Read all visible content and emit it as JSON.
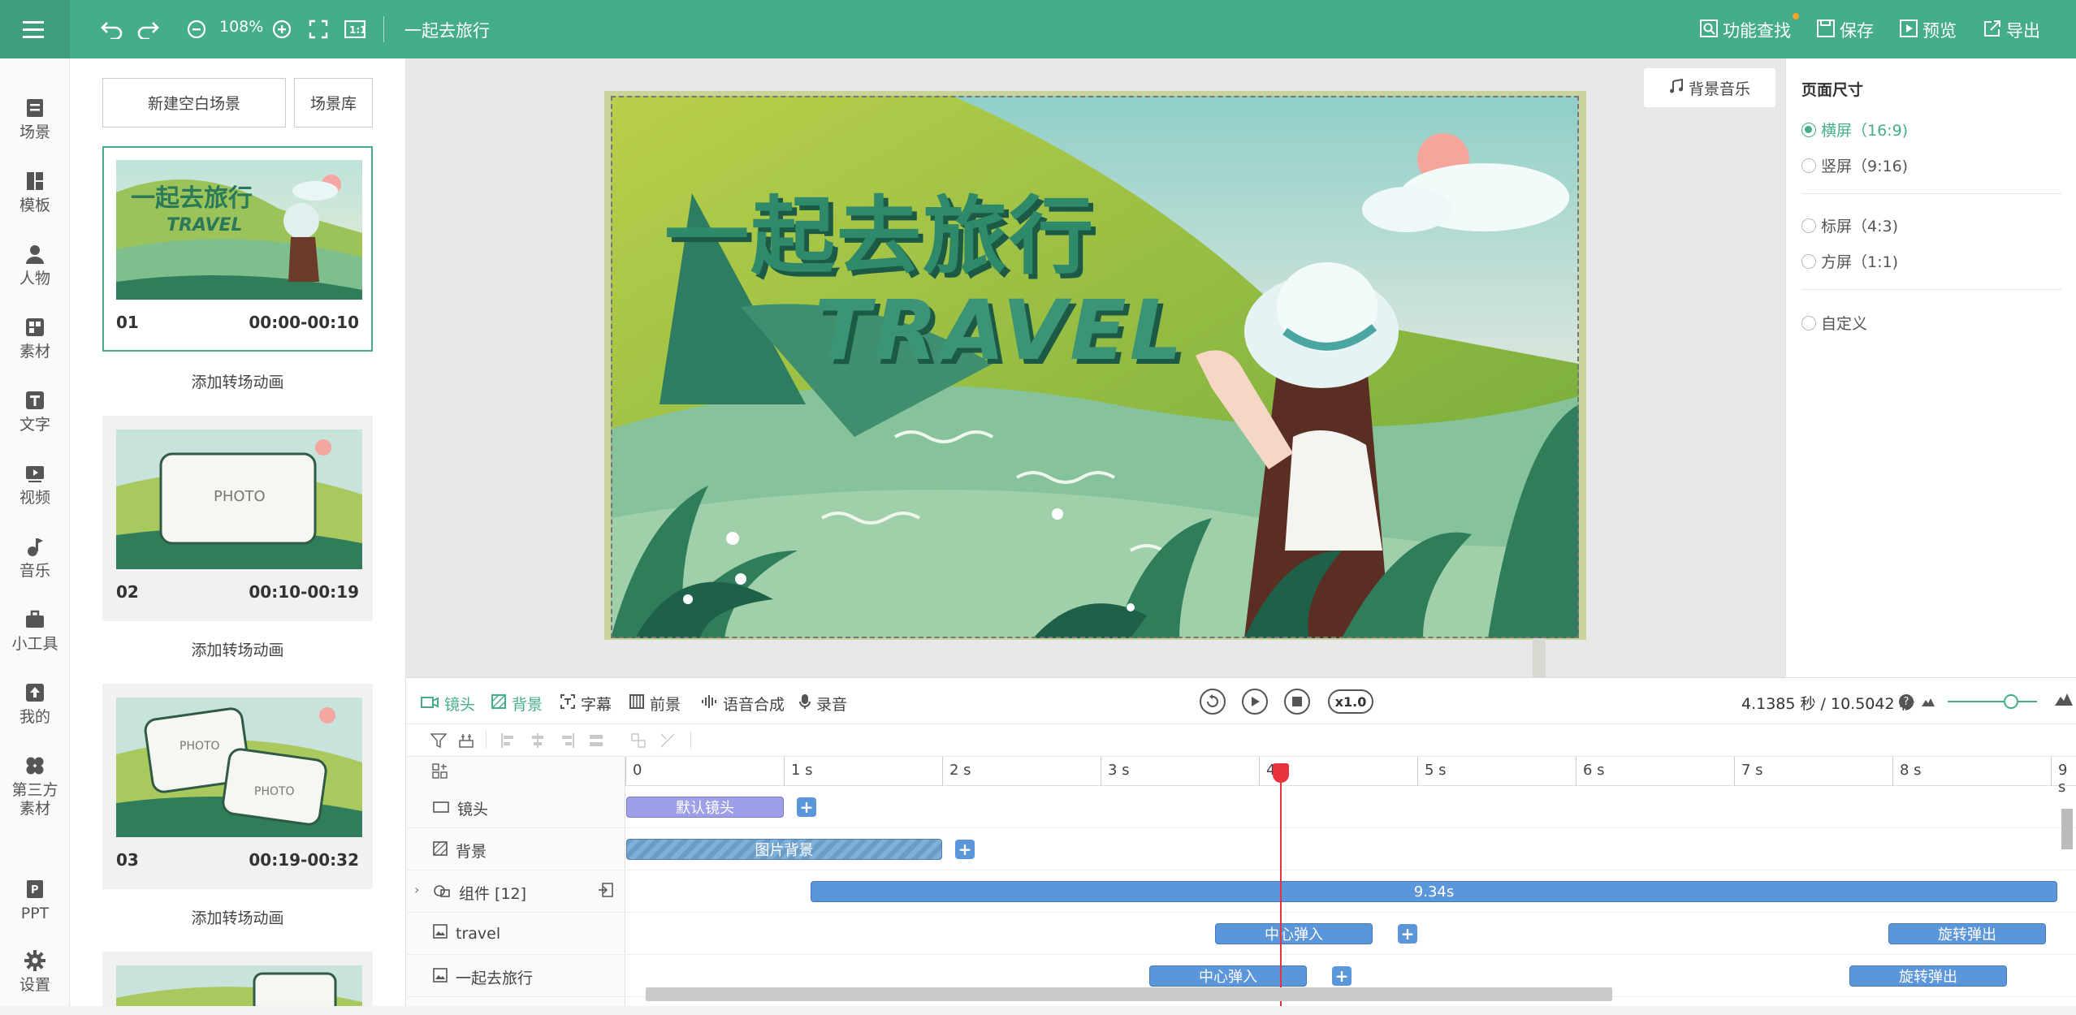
{
  "topbar": {
    "zoom": "108%",
    "doc_title": "一起去旅行",
    "feature_search": "功能查找",
    "save": "保存",
    "preview": "预览",
    "export": "导出"
  },
  "leftnav": [
    "场景",
    "模板",
    "人物",
    "素材",
    "文字",
    "视频",
    "音乐",
    "小工具",
    "我的",
    "第三方素材",
    "PPT",
    "设置"
  ],
  "scene_panel": {
    "new_blank": "新建空白场景",
    "library": "场景库",
    "add_transition": "添加转场动画",
    "scenes": [
      {
        "num": "01",
        "time": "00:00-00:10"
      },
      {
        "num": "02",
        "time": "00:10-00:19"
      },
      {
        "num": "03",
        "time": "00:19-00:32"
      }
    ],
    "thumb_title": "一起去旅行",
    "thumb_sub": "TRAVEL",
    "photo": "PHOTO"
  },
  "canvas": {
    "bg_music": "背景音乐",
    "title": "一起去旅行",
    "subtitle": "TRAVEL"
  },
  "right_panel": {
    "title": "页面尺寸",
    "options": [
      "横屏（16:9)",
      "竖屏（9:16)",
      "标屏（4:3)",
      "方屏（1:1)",
      "自定义"
    ],
    "selected": "横屏（16:9)"
  },
  "timeline": {
    "tabs": [
      "镜头",
      "背景",
      "字幕",
      "前景",
      "语音合成",
      "录音"
    ],
    "active_tab": "背景",
    "speed": "x1.0",
    "time_readout": "4.1385 秒 / 10.5042 秒",
    "ruler": [
      "0",
      "1 s",
      "2 s",
      "3 s",
      "4 s",
      "5 s",
      "6 s",
      "7 s",
      "8 s",
      "9 s"
    ],
    "tracks": [
      {
        "label": "镜头"
      },
      {
        "label": "背景"
      },
      {
        "label": "组件 [12]"
      },
      {
        "label": "travel"
      },
      {
        "label": "一起去旅行"
      }
    ],
    "clips": {
      "default_cam": "默认镜头",
      "image_bg": "图片背景",
      "group": "9.34s",
      "center_in": "中心弹入",
      "rotate_out": "旋转弹出"
    }
  },
  "colors": {
    "accent": "#46ad8c",
    "clip": "#5b95da",
    "playhead": "#e8323c"
  }
}
